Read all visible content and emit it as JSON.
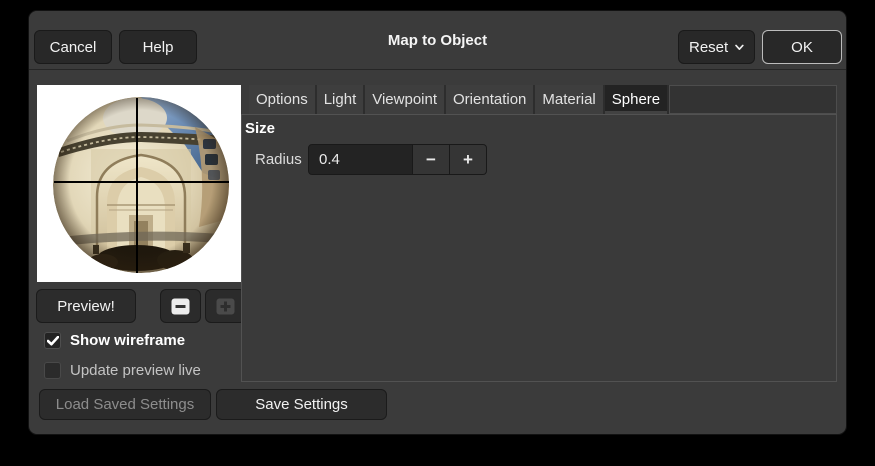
{
  "window": {
    "title": "Map to Object"
  },
  "header": {
    "cancel_label": "Cancel",
    "help_label": "Help",
    "reset_label": "Reset",
    "ok_label": "OK"
  },
  "preview": {
    "preview_button_label": "Preview!",
    "show_wireframe_label": "Show wireframe",
    "show_wireframe_checked": true,
    "update_preview_label": "Update preview live",
    "update_preview_checked": false
  },
  "tabs": [
    {
      "label": "Options",
      "selected": false
    },
    {
      "label": "Light",
      "selected": false
    },
    {
      "label": "Viewpoint",
      "selected": false
    },
    {
      "label": "Orientation",
      "selected": false
    },
    {
      "label": "Material",
      "selected": false
    },
    {
      "label": "Sphere",
      "selected": true
    }
  ],
  "sphere_panel": {
    "section_title": "Size",
    "radius_label": "Radius",
    "radius_value": "0.4",
    "spin_minus": "−",
    "spin_plus": "+"
  },
  "footer": {
    "load_label": "Load Saved Settings",
    "load_enabled": false,
    "save_label": "Save Settings"
  },
  "colors": {
    "dialog_bg": "#3b3b3b",
    "button_bg": "#282828",
    "input_bg": "#232323",
    "selected_tab_bg": "#232323",
    "ok_default_border": "#bcbcbc",
    "sky_blue": "#5b82ab",
    "marble_cream": "#e2d7b8"
  }
}
